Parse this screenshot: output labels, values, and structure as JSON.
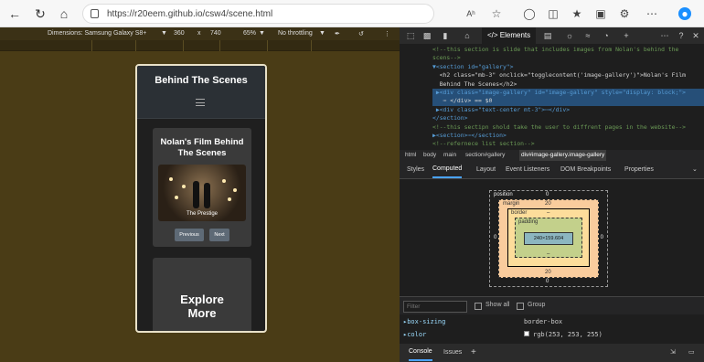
{
  "browser": {
    "url": "https://r20eem.github.io/csw4/scene.html",
    "read_aloud": "Aʰ",
    "icons": [
      "back-icon",
      "refresh-icon",
      "home-icon",
      "lock-icon",
      "favorite-icon",
      "collections-icon",
      "split-icon",
      "favorites-bar-icon",
      "extensions-icon",
      "more-icon",
      "copilot-icon"
    ]
  },
  "device_toolbar": {
    "dimensions_label": "Dimensions: Samsung Galaxy S8+",
    "width": "360",
    "x": "x",
    "height": "740",
    "zoom": "65%",
    "throttling": "No throttling"
  },
  "site": {
    "title": "Behind The Scenes",
    "card1_title": "Nolan's Film Behind The Scenes",
    "image_caption": "The Prestige",
    "prev_label": "Previous",
    "next_label": "Next",
    "card2_title": "Explore More"
  },
  "devtools": {
    "tabs": {
      "elements": "Elements"
    },
    "code": [
      {
        "text": "<!--this section is slide that includes images from Nolan's behind the",
        "cls": "cm"
      },
      {
        "text": "scens-->",
        "cls": "cm"
      },
      {
        "text": "▼<section id=\"gallery\">",
        "cls": "tg"
      },
      {
        "text": "  <h2 class=\"mb-3\" onclick=\"togglecontent('image-gallery')\">Nolan's Film",
        "cls": "tx"
      },
      {
        "text": "  Behind The Scenes</h2>",
        "cls": "tx"
      },
      {
        "text": " ▶<div class=\"image-gallery\" id=\"image-gallery\" style=\"display: block;\">",
        "cls": "tg"
      },
      {
        "text": "   ⋯ </div> == $0",
        "cls": "tx"
      },
      {
        "text": " ▶<div class=\"text-center mt-3\">⋯</div>",
        "cls": "tg"
      },
      {
        "text": "</section>",
        "cls": "tg"
      },
      {
        "text": "<!--this sectipn shold take the user to diffrent pages in the website-->",
        "cls": "cm"
      },
      {
        "text": "▶<section>⋯</section>",
        "cls": "tg"
      },
      {
        "text": "<!--refernece list section-->",
        "cls": "cm"
      }
    ],
    "breadcrumbs": [
      "html",
      "body",
      "main",
      "section#gallery",
      "div#image-gallery.image-gallery"
    ],
    "subtabs": [
      "Styles",
      "Computed",
      "Layout",
      "Event Listeners",
      "DOM Breakpoints",
      "Properties"
    ],
    "box": {
      "position_label": "position",
      "position_val": "0",
      "margin_label": "margin",
      "margin_val": "20",
      "border_label": "border",
      "border_val": "–",
      "padding_label": "padding",
      "padding_val": "–",
      "content": "240×159.604",
      "side0": "0",
      "side_dash": "-",
      "bottom_margin": "20",
      "bottom_pos": "0"
    },
    "filter": {
      "placeholder": "Filter",
      "show_all": "Show all",
      "group": "Group"
    },
    "properties": [
      {
        "name": "box-sizing",
        "value": "border-box"
      },
      {
        "name": "color",
        "value": "rgb(253, 253, 255)"
      }
    ],
    "drawer": {
      "console": "Console",
      "issues": "Issues"
    }
  }
}
